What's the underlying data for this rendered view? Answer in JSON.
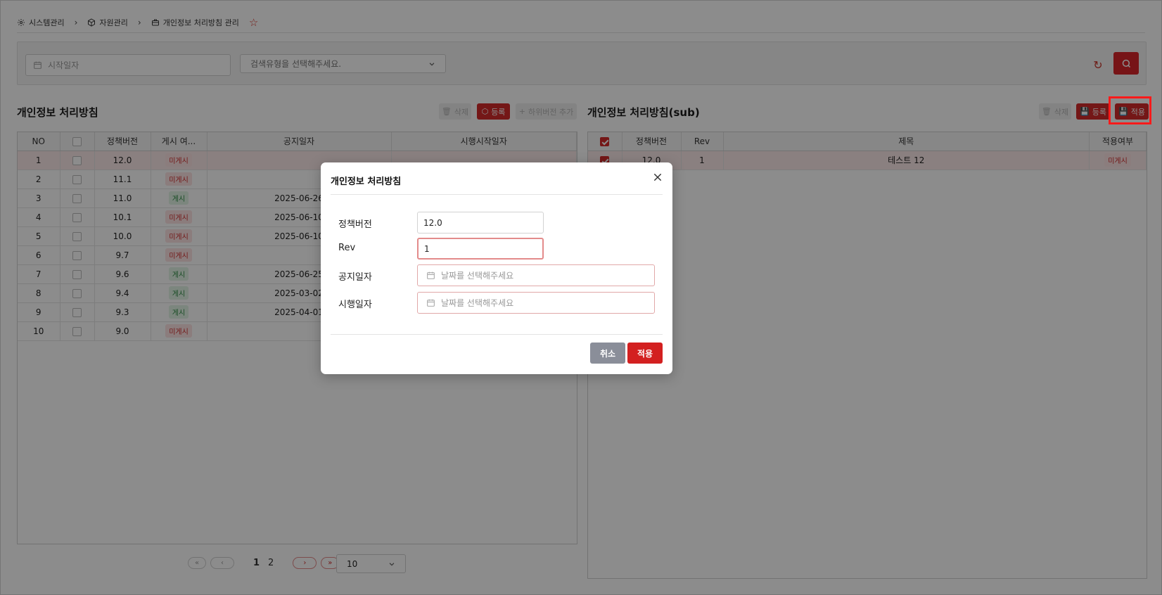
{
  "breadcrumb": {
    "items": [
      {
        "label": "시스템관리",
        "icon": "gear-icon"
      },
      {
        "label": "자원관리",
        "icon": "cube-icon"
      },
      {
        "label": "개인정보 처리방침 관리",
        "icon": "briefcase-icon"
      }
    ]
  },
  "search": {
    "date_placeholder": "시작일자",
    "type_placeholder": "검색유형을 선택해주세요."
  },
  "left": {
    "title": "개인정보 처리방침",
    "buttons": {
      "delete": "삭제",
      "register": "등록",
      "add_sub": "하위버전 추가"
    },
    "columns": [
      "NO",
      "",
      "정책버전",
      "게시 여...",
      "공지일자",
      "시행시작일자"
    ],
    "rows": [
      {
        "no": "1",
        "version": "12.0",
        "status": "미게시",
        "notice": "",
        "start": ""
      },
      {
        "no": "2",
        "version": "11.1",
        "status": "미게시",
        "notice": "",
        "start": ""
      },
      {
        "no": "3",
        "version": "11.0",
        "status": "게시",
        "notice": "2025-06-26",
        "start": ""
      },
      {
        "no": "4",
        "version": "10.1",
        "status": "미게시",
        "notice": "2025-06-10",
        "start": ""
      },
      {
        "no": "5",
        "version": "10.0",
        "status": "미게시",
        "notice": "2025-06-10",
        "start": ""
      },
      {
        "no": "6",
        "version": "9.7",
        "status": "미게시",
        "notice": "",
        "start": ""
      },
      {
        "no": "7",
        "version": "9.6",
        "status": "게시",
        "notice": "2025-06-25",
        "start": ""
      },
      {
        "no": "8",
        "version": "9.4",
        "status": "게시",
        "notice": "2025-03-02",
        "start": ""
      },
      {
        "no": "9",
        "version": "9.3",
        "status": "게시",
        "notice": "2025-04-01",
        "start": ""
      },
      {
        "no": "10",
        "version": "9.0",
        "status": "미게시",
        "notice": "",
        "start": ""
      }
    ],
    "pagination": {
      "pages": [
        "1",
        "2"
      ],
      "current": "1",
      "page_size": "10"
    }
  },
  "right": {
    "title": "개인정보 처리방침(sub)",
    "buttons": {
      "delete": "삭제",
      "register": "등록",
      "apply": "적용"
    },
    "columns": [
      "",
      "정책버전",
      "Rev",
      "제목",
      "적용여부"
    ],
    "rows": [
      {
        "version": "12.0",
        "rev": "1",
        "title": "테스트 12",
        "status": "미게시"
      }
    ]
  },
  "modal": {
    "title": "개인정보 처리방침",
    "fields": {
      "version_label": "정책버전",
      "version_value": "12.0",
      "rev_label": "Rev",
      "rev_value": "1",
      "notice_label": "공지일자",
      "notice_placeholder": "날짜를 선택해주세요",
      "start_label": "시행일자",
      "start_placeholder": "날짜를 선택해주세요"
    },
    "cancel": "취소",
    "apply": "적용"
  },
  "colors": {
    "accent": "#d32a2a",
    "published": "#2d8a43",
    "unpublished": "#d22c2c",
    "cancel": "#8a8e99"
  }
}
